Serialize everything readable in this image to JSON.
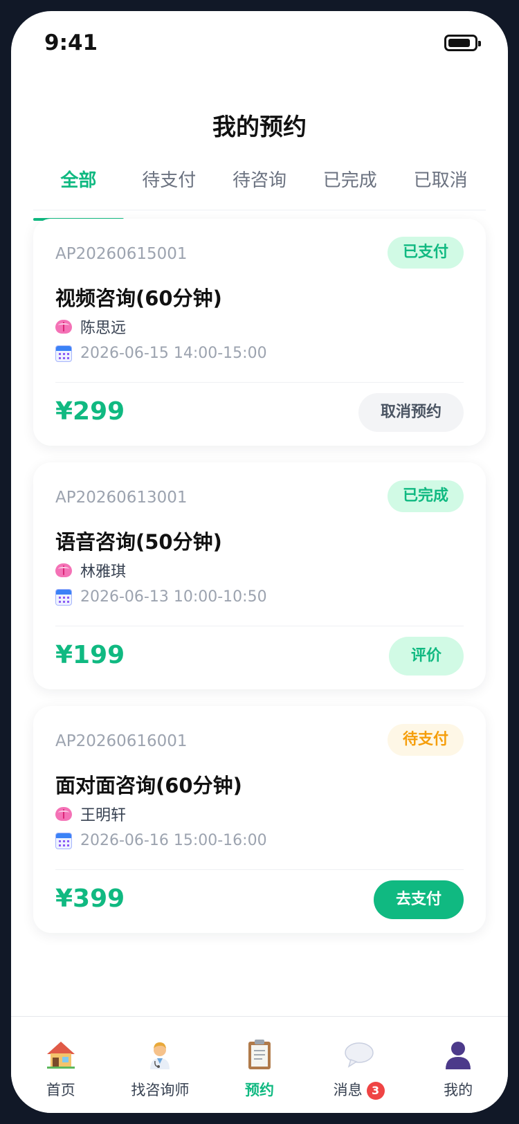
{
  "status_bar": {
    "time": "9:41"
  },
  "header": {
    "title": "我的预约"
  },
  "tabs": [
    {
      "label": "全部",
      "active": true
    },
    {
      "label": "待支付",
      "active": false
    },
    {
      "label": "待咨询",
      "active": false
    },
    {
      "label": "已完成",
      "active": false
    },
    {
      "label": "已取消",
      "active": false
    }
  ],
  "appointments": [
    {
      "order_no": "AP20260615001",
      "status": "已支付",
      "service": "视频咨询(60分钟)",
      "counselor": "陈思远",
      "time": "2026-06-15 14:00-15:00",
      "price": "¥299",
      "action": "取消预约"
    },
    {
      "order_no": "AP20260613001",
      "status": "已完成",
      "service": "语音咨询(50分钟)",
      "counselor": "林雅琪",
      "time": "2026-06-13 10:00-10:50",
      "price": "¥199",
      "action": "评价"
    },
    {
      "order_no": "AP20260616001",
      "status": "待支付",
      "service": "面对面咨询(60分钟)",
      "counselor": "王明轩",
      "time": "2026-06-16 15:00-16:00",
      "price": "¥399",
      "action": "去支付"
    }
  ],
  "tabbar": {
    "items": [
      {
        "label": "首页",
        "icon": "house-icon"
      },
      {
        "label": "找咨询师",
        "icon": "doctor-icon"
      },
      {
        "label": "预约",
        "icon": "clipboard-icon",
        "active": true
      },
      {
        "label": "消息",
        "icon": "speech-bubble-icon",
        "badge": "3"
      },
      {
        "label": "我的",
        "icon": "person-icon"
      }
    ]
  },
  "colors": {
    "accent": "#10b981",
    "badge_green_bg": "#d1fae5",
    "badge_orange_bg": "#fef7e6",
    "badge_orange_text": "#f59e0b",
    "notification_red": "#ef4444",
    "frame": "#111827"
  }
}
